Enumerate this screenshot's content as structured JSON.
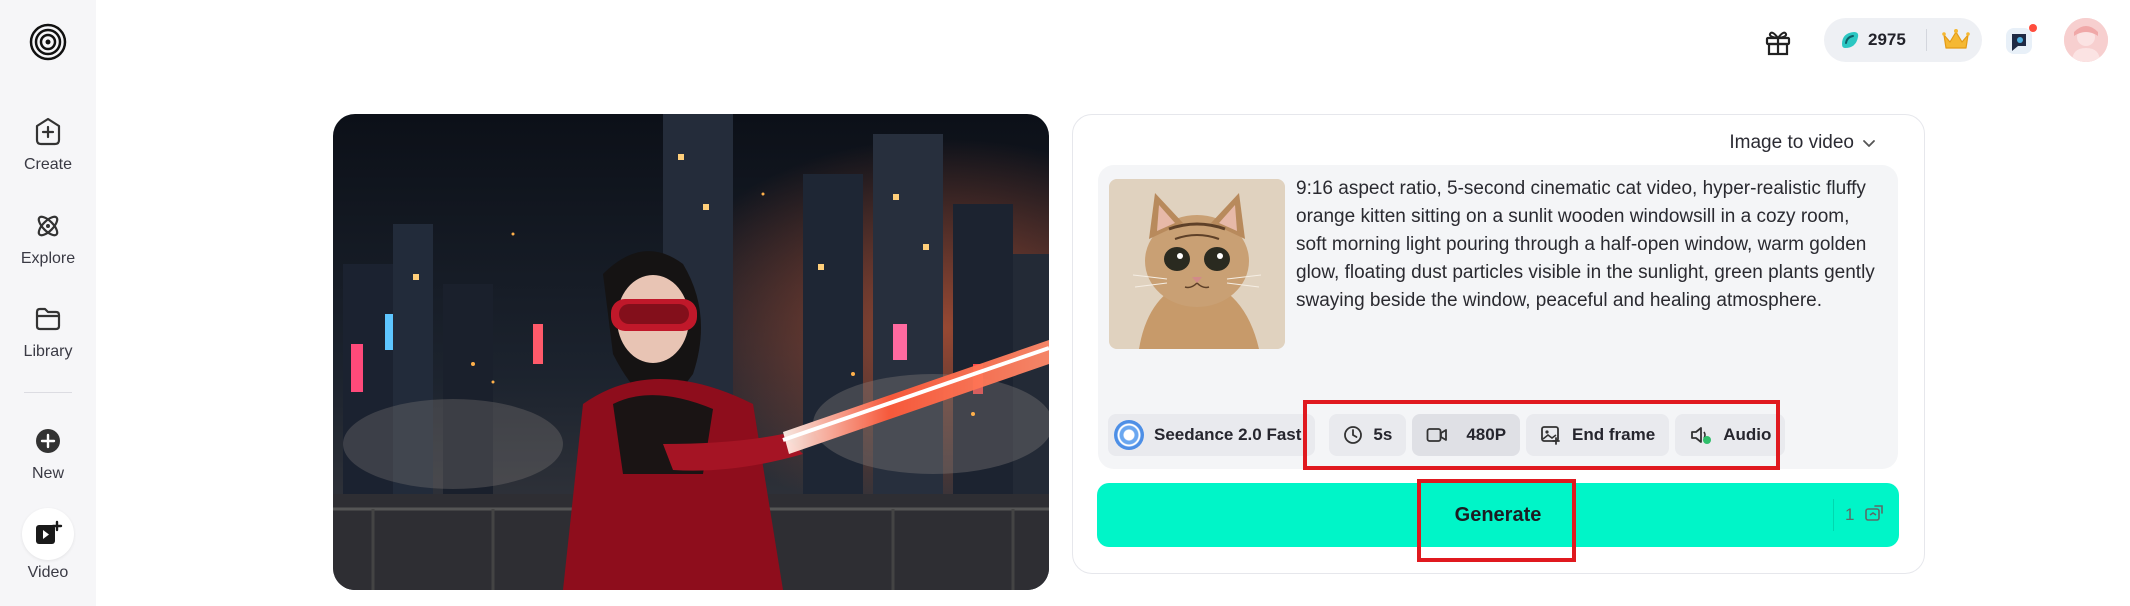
{
  "sidebar": {
    "items": [
      {
        "label": "Create",
        "icon": "create-icon"
      },
      {
        "label": "Explore",
        "icon": "explore-icon"
      },
      {
        "label": "Library",
        "icon": "folder-icon"
      },
      {
        "label": "New",
        "icon": "plus-circle-icon"
      },
      {
        "label": "Video",
        "icon": "video-plus-icon"
      }
    ]
  },
  "topbar": {
    "credits": "2975",
    "icons": [
      "gift-icon",
      "credits-coin-icon",
      "crown-icon",
      "notification-icon",
      "avatar"
    ]
  },
  "panel": {
    "mode": "Image to video",
    "prompt": "9:16 aspect ratio, 5-second cinematic cat video, hyper-realistic fluffy orange kitten sitting on a sunlit wooden windowsill in a cozy room, soft morning light pouring through a half-open window, warm golden glow, floating dust particles visible in the sunlight, green plants gently swaying beside the window, peaceful and healing atmosphere.",
    "model": "Seedance 2.0 Fast",
    "options": {
      "duration": "5s",
      "resolution": "480P",
      "end_frame": "End frame",
      "audio": "Audio"
    },
    "generate_label": "Generate",
    "generate_count": "1"
  },
  "colors": {
    "accent": "#00f5c8",
    "highlight": "#e0191f",
    "sidebar_bg": "#f6f6f8"
  }
}
